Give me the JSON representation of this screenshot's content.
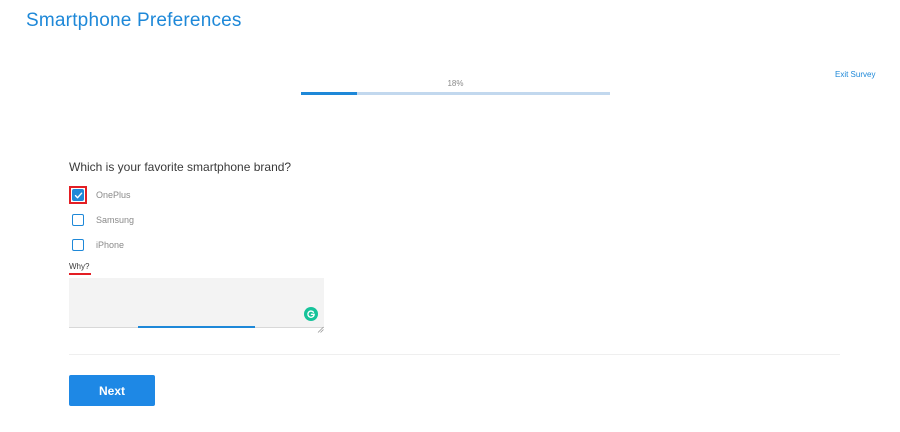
{
  "header": {
    "title": "Smartphone Preferences",
    "exit_label": "Exit Survey"
  },
  "progress": {
    "label": "18%",
    "fraction": 0.18
  },
  "question": {
    "text": "Which is your favorite smartphone brand?",
    "options": [
      {
        "label": "OnePlus",
        "checked": true,
        "focused": true
      },
      {
        "label": "Samsung",
        "checked": false,
        "focused": false
      },
      {
        "label": "iPhone",
        "checked": false,
        "focused": false
      }
    ]
  },
  "why": {
    "label": "Why?",
    "value": ""
  },
  "footer": {
    "next_label": "Next"
  },
  "colors": {
    "accent": "#1e88d8",
    "focus_outline": "#e31e24",
    "grammarly": "#15c39a"
  },
  "icons": {
    "checkbox_checked": "check-icon",
    "grammarly": "grammarly-icon",
    "resize": "resize-handle-icon"
  }
}
